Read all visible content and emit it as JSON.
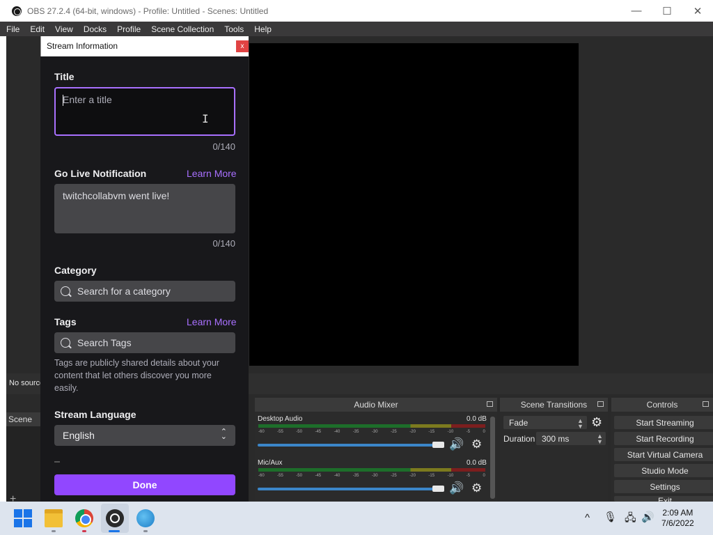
{
  "window": {
    "title": "OBS 27.2.4 (64-bit, windows) - Profile: Untitled - Scenes: Untitled",
    "controls": {
      "minimize": "—",
      "maximize": "☐",
      "close": "✕"
    }
  },
  "menubar": [
    "File",
    "Edit",
    "View",
    "Docks",
    "Profile",
    "Scene Collection",
    "Tools",
    "Help"
  ],
  "sources": {
    "empty_text": "No source"
  },
  "scenes": {
    "title": "Scene",
    "add": "+"
  },
  "audio_mixer": {
    "title": "Audio Mixer",
    "ticks": [
      "-60",
      "-55",
      "-50",
      "-45",
      "-40",
      "-35",
      "-30",
      "-25",
      "-20",
      "-15",
      "-10",
      "-5",
      "0"
    ],
    "channels": [
      {
        "name": "Desktop Audio",
        "db": "0.0 dB",
        "volume": 1.0
      },
      {
        "name": "Mic/Aux",
        "db": "0.0 dB",
        "volume": 1.0
      }
    ]
  },
  "scene_transitions": {
    "title": "Scene Transitions",
    "transition": "Fade",
    "duration_label": "Duration",
    "duration_value": "300 ms"
  },
  "controls": {
    "title": "Controls",
    "buttons": [
      "Start Streaming",
      "Start Recording",
      "Start Virtual Camera",
      "Studio Mode",
      "Settings",
      "Exit"
    ]
  },
  "dialog": {
    "title": "Stream Information",
    "close": "x",
    "title_label": "Title",
    "title_placeholder": "Enter a title",
    "title_counter": "0/140",
    "notification_label": "Go Live Notification",
    "notification_link": "Learn More",
    "notification_text": "twitchcollabvm went live!",
    "notification_counter": "0/140",
    "category_label": "Category",
    "category_placeholder": "Search for a category",
    "tags_label": "Tags",
    "tags_link": "Learn More",
    "tags_placeholder": "Search Tags",
    "tags_help": "Tags are publicly shared details about your content that let others discover you more easily.",
    "language_label": "Stream Language",
    "language_value": "English",
    "done": "Done"
  },
  "taskbar": {
    "time": "2:09 AM",
    "date": "7/6/2022",
    "tray": {
      "chevron": "^",
      "mic": "🎙",
      "network": "🖧",
      "volume": "🔊"
    }
  },
  "colors": {
    "accent": "#9147ff",
    "link": "#a970ff",
    "dialog_bg": "#18181b"
  }
}
